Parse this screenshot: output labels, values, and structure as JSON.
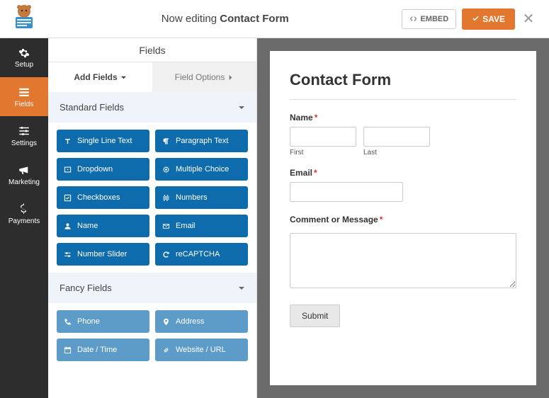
{
  "header": {
    "editing_prefix": "Now editing ",
    "editing_title": "Contact Form",
    "embed_label": "EMBED",
    "save_label": "SAVE"
  },
  "sidenav": {
    "setup": "Setup",
    "fields": "Fields",
    "settings": "Settings",
    "marketing": "Marketing",
    "payments": "Payments"
  },
  "section_title": "Fields",
  "tabs": {
    "add": "Add Fields",
    "options": "Field Options"
  },
  "groups": {
    "standard": {
      "title": "Standard Fields",
      "items": [
        "Single Line Text",
        "Paragraph Text",
        "Dropdown",
        "Multiple Choice",
        "Checkboxes",
        "Numbers",
        "Name",
        "Email",
        "Number Slider",
        "reCAPTCHA"
      ]
    },
    "fancy": {
      "title": "Fancy Fields",
      "items": [
        "Phone",
        "Address",
        "Date / Time",
        "Website / URL"
      ]
    }
  },
  "preview": {
    "form_title": "Contact Form",
    "name_label": "Name",
    "first": "First",
    "last": "Last",
    "email_label": "Email",
    "message_label": "Comment or Message",
    "submit": "Submit",
    "required": "*"
  }
}
